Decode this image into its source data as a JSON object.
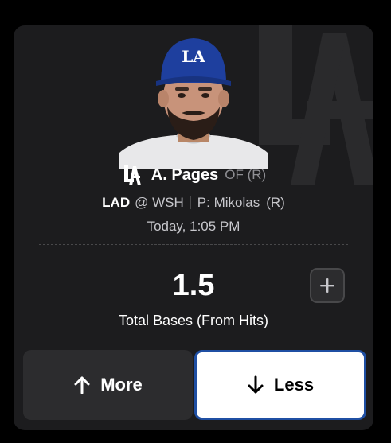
{
  "player": {
    "name": "A. Pages",
    "position": "OF (R)",
    "team_logo": "la-dodgers-logo"
  },
  "matchup": {
    "team": "LAD",
    "opponent": "@ WSH",
    "pitcher": "P: Mikolas",
    "pitcher_hand": "(R)"
  },
  "time": "Today, 1:05 PM",
  "projection": {
    "line": "1.5",
    "stat": "Total Bases (From Hits)"
  },
  "buttons": {
    "more_label": "More",
    "less_label": "Less",
    "selected": "less"
  },
  "colors": {
    "card_bg": "#1c1c1e",
    "accent_border": "#1f4fa3",
    "cap_blue": "#1e3f9e"
  },
  "icons": {
    "add": "plus-icon",
    "more": "arrow-up-icon",
    "less": "arrow-down-icon"
  }
}
